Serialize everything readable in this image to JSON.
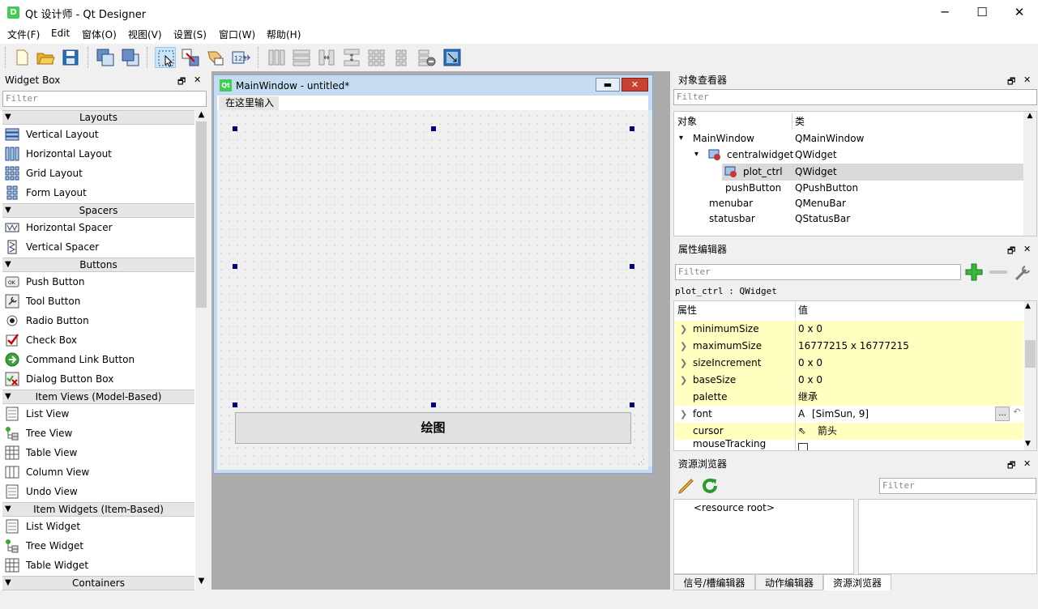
{
  "window": {
    "title": "Qt 设计师 - Qt Designer",
    "icon_letter": "D",
    "minimize": "─",
    "maximize": "☐",
    "close": "✕"
  },
  "menu": [
    "文件(F)",
    "Edit",
    "窗体(O)",
    "视图(V)",
    "设置(S)",
    "窗口(W)",
    "帮助(H)"
  ],
  "toolbar": {
    "icons": [
      "new-file-icon",
      "open-folder-icon",
      "save-icon",
      "send-to-back-icon",
      "bring-to-front-icon",
      "edit-widgets-icon",
      "edit-signals-icon",
      "edit-buddies-icon",
      "edit-tab-order-icon",
      "lay-out-horizontally-icon",
      "lay-out-vertically-icon",
      "horizontal-splitter-icon",
      "vertical-splitter-icon",
      "grid-layout-icon",
      "form-layout-icon",
      "break-layout-icon",
      "adjust-size-icon"
    ]
  },
  "widget_box": {
    "title": "Widget Box",
    "filter_placeholder": "Filter",
    "categories": [
      {
        "label": "Layouts",
        "items": [
          "Vertical Layout",
          "Horizontal Layout",
          "Grid Layout",
          "Form Layout"
        ]
      },
      {
        "label": "Spacers",
        "items": [
          "Horizontal Spacer",
          "Vertical Spacer"
        ]
      },
      {
        "label": "Buttons",
        "items": [
          "Push Button",
          "Tool Button",
          "Radio Button",
          "Check Box",
          "Command Link Button",
          "Dialog Button Box"
        ]
      },
      {
        "label": "Item Views (Model-Based)",
        "items": [
          "List View",
          "Tree View",
          "Table View",
          "Column View",
          "Undo View"
        ]
      },
      {
        "label": "Item Widgets (Item-Based)",
        "items": [
          "List Widget",
          "Tree Widget",
          "Table Widget"
        ]
      },
      {
        "label": "Containers",
        "items": []
      }
    ]
  },
  "form": {
    "title": "MainWindow - untitled*",
    "icon_text": "Qt",
    "menu_placeholder": "在这里输入",
    "push_button_label": "绘图"
  },
  "object_inspector": {
    "title": "对象查看器",
    "filter_placeholder": "Filter",
    "col_object": "对象",
    "col_class": "类",
    "rows": [
      {
        "name": "MainWindow",
        "class": "QMainWindow"
      },
      {
        "name": "centralwidget",
        "class": "QWidget"
      },
      {
        "name": "plot_ctrl",
        "class": "QWidget"
      },
      {
        "name": "pushButton",
        "class": "QPushButton"
      },
      {
        "name": "menubar",
        "class": "QMenuBar"
      },
      {
        "name": "statusbar",
        "class": "QStatusBar"
      }
    ]
  },
  "property_editor": {
    "title": "属性编辑器",
    "filter_placeholder": "Filter",
    "context": "plot_ctrl : QWidget",
    "col_property": "属性",
    "col_value": "值",
    "rows": [
      {
        "name": "minimumSize",
        "value": "0 x 0"
      },
      {
        "name": "maximumSize",
        "value": "16777215 x 16777215"
      },
      {
        "name": "sizeIncrement",
        "value": "0 x 0"
      },
      {
        "name": "baseSize",
        "value": "0 x 0"
      },
      {
        "name": "palette",
        "value": "继承"
      },
      {
        "name": "font",
        "value": "[SimSun, 9]"
      },
      {
        "name": "cursor",
        "value": "箭头"
      },
      {
        "name": "mouseTracking",
        "value": ""
      }
    ],
    "font_icon": "A",
    "dots": "...",
    "reset": "↶"
  },
  "resource_browser": {
    "title": "资源浏览器",
    "filter_placeholder": "Filter",
    "root": "<resource root>"
  },
  "bottom_tabs": [
    "信号/槽编辑器",
    "动作编辑器",
    "资源浏览器"
  ],
  "dock_float": "🗗",
  "dock_close": "✕"
}
